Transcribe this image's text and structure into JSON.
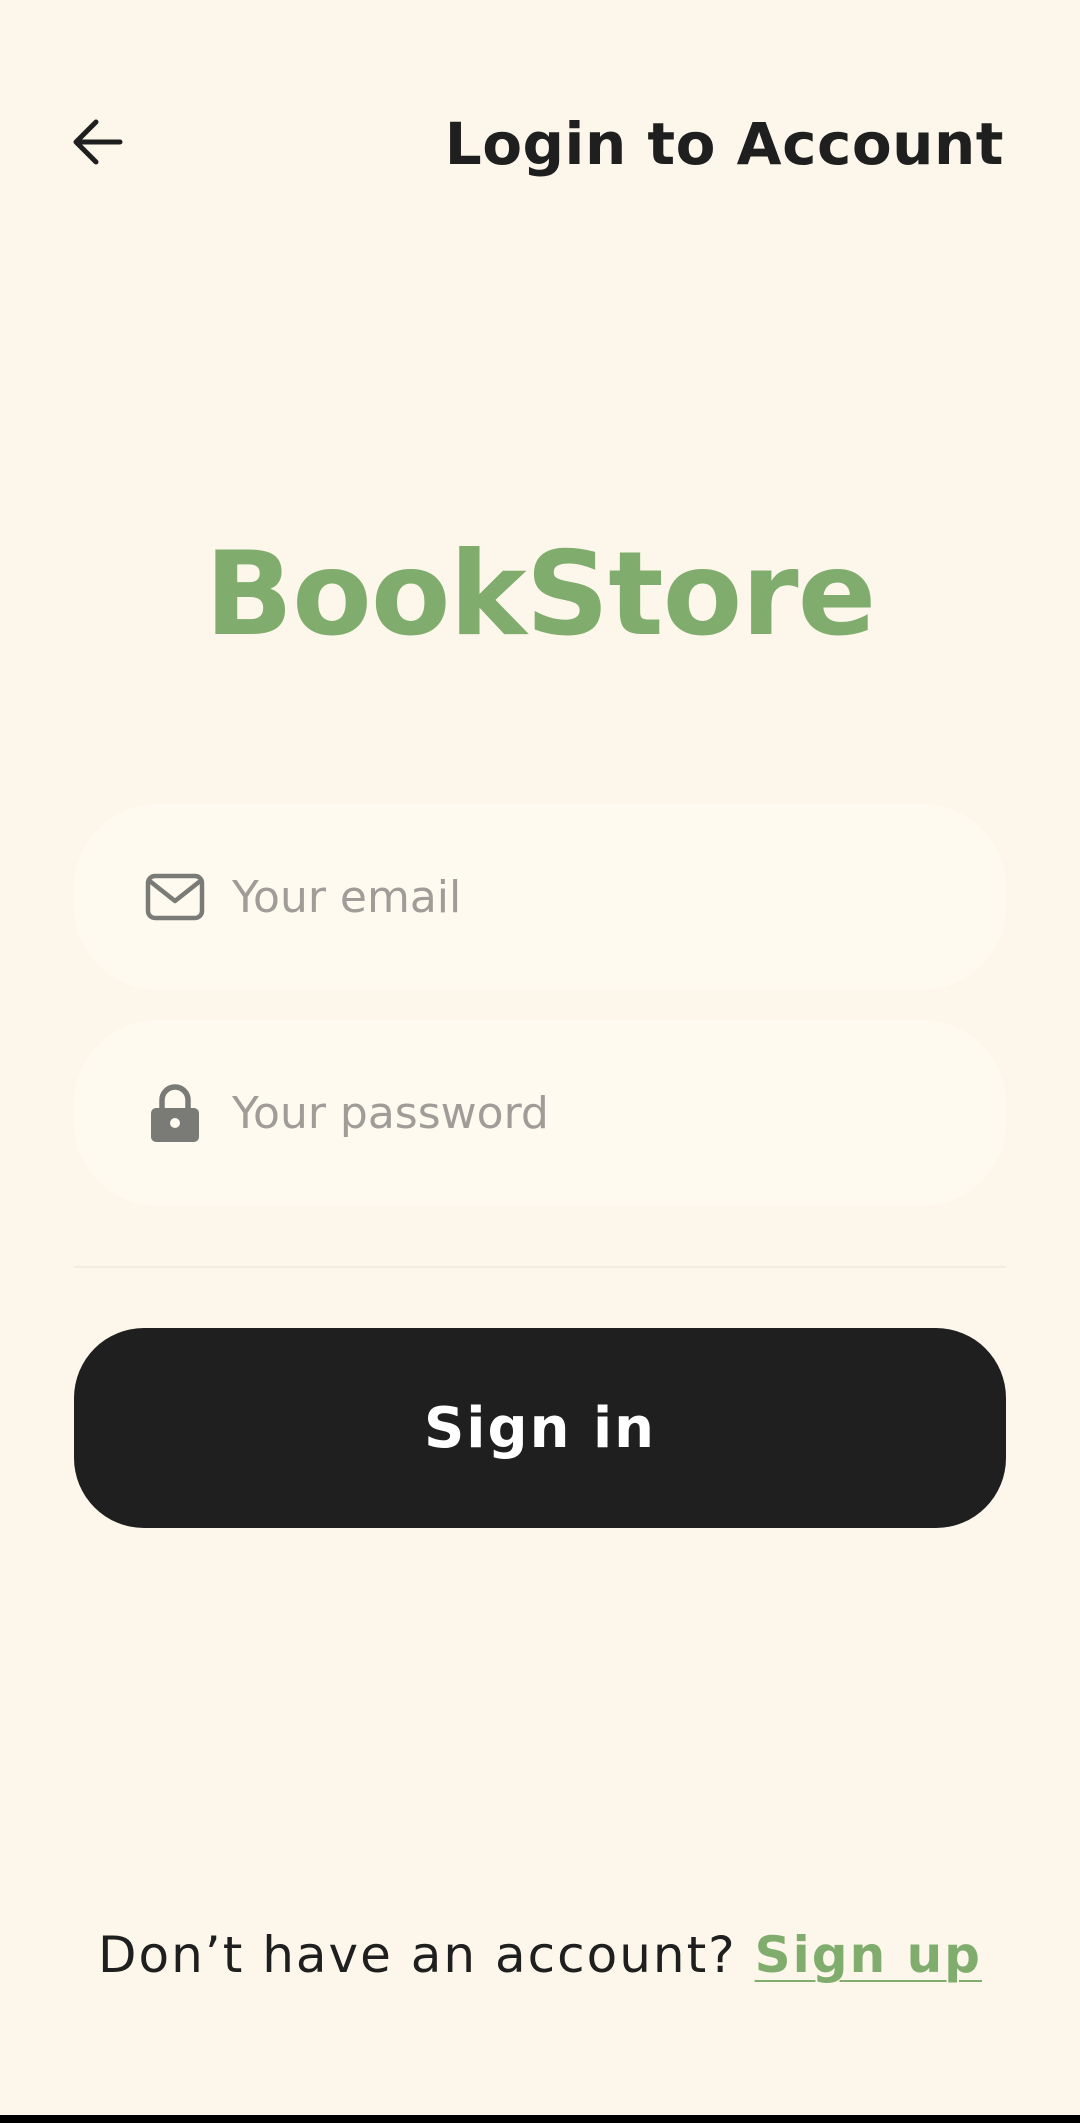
{
  "header": {
    "back_icon": "arrow-left-icon",
    "title": "Login to Account"
  },
  "brand": {
    "name": "BookStore",
    "color": "#80ad6d"
  },
  "form": {
    "email": {
      "icon": "envelope-icon",
      "placeholder": "Your email",
      "value": ""
    },
    "password": {
      "icon": "lock-icon",
      "placeholder": "Your password",
      "value": ""
    },
    "submit_label": "Sign in"
  },
  "footer": {
    "prompt": "Don’t have an account?",
    "link_label": "Sign up"
  },
  "colors": {
    "background": "#fdf6ea",
    "field_background": "#fffaf0",
    "button": "#1f1f1f",
    "accent": "#80ad6d",
    "placeholder": "#a09c98"
  }
}
